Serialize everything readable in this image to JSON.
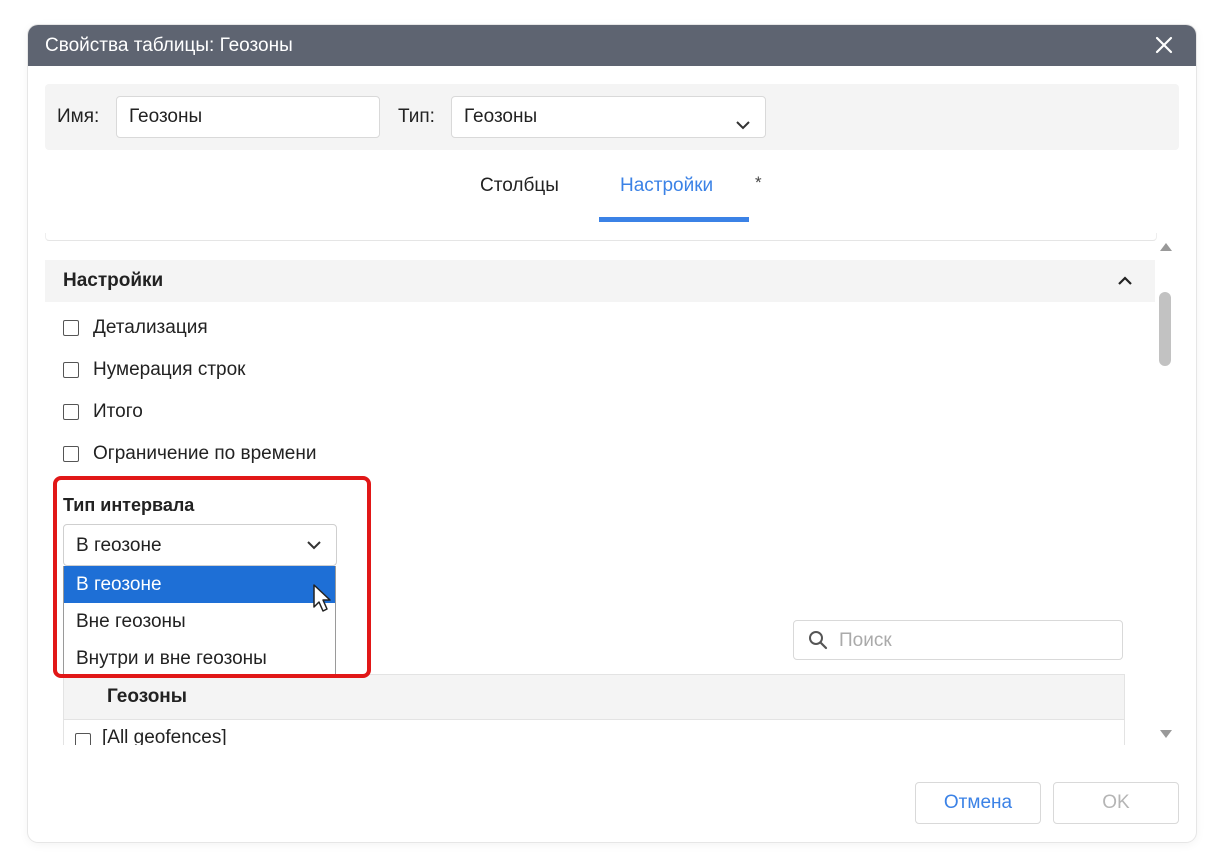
{
  "dialog": {
    "title": "Свойства таблицы: Геозоны"
  },
  "header": {
    "name_label": "Имя:",
    "name_value": "Геозоны",
    "type_label": "Тип:",
    "type_value": "Геозоны"
  },
  "tabs": [
    {
      "label": "Столбцы",
      "active": false
    },
    {
      "label": "Настройки",
      "active": true
    }
  ],
  "tabs_marker": "*",
  "settings": {
    "section_title": "Настройки",
    "checkboxes": [
      {
        "label": "Детализация",
        "checked": false
      },
      {
        "label": "Нумерация строк",
        "checked": false
      },
      {
        "label": "Итого",
        "checked": false
      },
      {
        "label": "Ограничение по времени",
        "checked": false
      }
    ],
    "interval_label": "Тип интервала",
    "interval_value": "В геозоне",
    "interval_options": [
      {
        "label": "В геозоне",
        "selected": true
      },
      {
        "label": "Вне геозоны",
        "selected": false
      },
      {
        "label": "Внутри и вне геозоны",
        "selected": false
      }
    ]
  },
  "geofences": {
    "search_placeholder": "Поиск",
    "column_header": "Геозоны",
    "rows": [
      {
        "label": "[All geofences]",
        "checked": false
      }
    ]
  },
  "footer": {
    "cancel_label": "Отмена",
    "ok_label": "OK"
  },
  "colors": {
    "titlebar": "#5e6471",
    "accent": "#3b82e6",
    "selected_option": "#1e6fd6",
    "highlight_box": "#e11717"
  }
}
